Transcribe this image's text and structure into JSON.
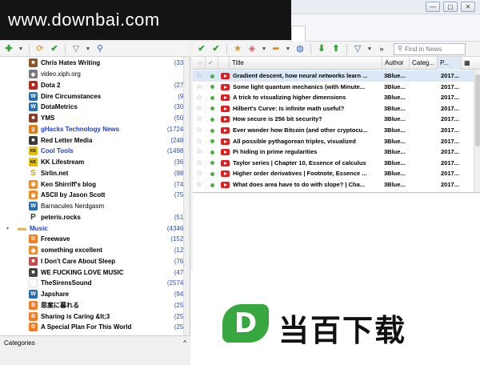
{
  "watermark": {
    "top_text": "www.downbai.com",
    "logo_letter": "D",
    "logo_text": "当百下载"
  },
  "window_controls": {
    "minimize": "—",
    "maximize": "▢",
    "close": "✕"
  },
  "feeds_toolbar": {
    "icons": [
      "add-icon",
      "dropdown-icon",
      "folder-update-icon",
      "mark-read-icon",
      "filter-icon",
      "dropdown-icon",
      "search-icon"
    ]
  },
  "news_toolbar": {
    "icons": [
      "mark-read-icon",
      "mark-all-read-icon",
      "star-icon",
      "tag-icon",
      "share-icon",
      "open-browser-icon",
      "down-icon",
      "up-icon",
      "filter-icon"
    ],
    "search_placeholder": "Find in News",
    "search_scope_label": "»"
  },
  "feeds": [
    {
      "label": "Chris Hates Writing",
      "count": "(33)",
      "style": "bold",
      "icon": "chris-icon",
      "color": "#8b5a2b",
      "glyph": "■"
    },
    {
      "label": "video.xiph.org",
      "count": "",
      "style": "thin",
      "icon": "xiph-icon",
      "color": "#7a7a7a",
      "glyph": "◆"
    },
    {
      "label": "Dota 2",
      "count": "(27)",
      "style": "bold",
      "icon": "dota-icon",
      "color": "#b5281e",
      "glyph": "■"
    },
    {
      "label": "Dire Circumstances",
      "count": "(9)",
      "style": "bold",
      "icon": "wordpress-icon",
      "color": "#2a6db0",
      "glyph": "W"
    },
    {
      "label": "DotaMetrics",
      "count": "(30)",
      "style": "bold",
      "icon": "wordpress-icon",
      "color": "#2a6db0",
      "glyph": "W"
    },
    {
      "label": "YMS",
      "count": "(50)",
      "style": "bold",
      "icon": "yms-icon",
      "color": "#8a3b2e",
      "glyph": "■"
    },
    {
      "label": "gHacks Technology News",
      "count": "(1724)",
      "style": "blue",
      "icon": "ghacks-icon",
      "color": "#e07b1a",
      "glyph": "g"
    },
    {
      "label": "Red Letter Media",
      "count": "(248)",
      "style": "bold",
      "icon": "rlm-icon",
      "color": "#3a3a3a",
      "glyph": "■"
    },
    {
      "label": "Cool Tools",
      "count": "(1498)",
      "style": "blue",
      "icon": "kk-icon",
      "color": "#e8c000",
      "glyph": "KK"
    },
    {
      "label": "KK Lifestream",
      "count": "(36)",
      "style": "bold",
      "icon": "kk-icon",
      "color": "#e8c000",
      "glyph": "KK"
    },
    {
      "label": "Sirlin.net",
      "count": "(98)",
      "style": "bold",
      "icon": "sirlin-icon",
      "color": "#c9a400",
      "glyph": "S"
    },
    {
      "label": "Ken Shirriff's blog",
      "count": "(74)",
      "style": "bold",
      "icon": "rss-icon",
      "color": "#f08a24",
      "glyph": "◉"
    },
    {
      "label": "ASCII by Jason Scott",
      "count": "(75)",
      "style": "bold",
      "icon": "rss-icon",
      "color": "#f08a24",
      "glyph": "◉"
    },
    {
      "label": "Barnacules Nerdgasm",
      "count": "",
      "style": "thin",
      "icon": "wordpress-icon",
      "color": "#2a6db0",
      "glyph": "W"
    },
    {
      "label": "peteris.rocks",
      "count": "(51)",
      "style": "bold",
      "icon": "peteris-icon",
      "color": "#333333",
      "glyph": "P"
    },
    {
      "label": "Music",
      "count": "(4346)",
      "style": "blue",
      "icon": "folder-icon",
      "color": "#e9b840",
      "glyph": "▬",
      "folder": true
    },
    {
      "label": "Freewave",
      "count": "(152)",
      "style": "bold",
      "icon": "blogger-icon",
      "color": "#f57c1f",
      "glyph": "B"
    },
    {
      "label": "something excellent",
      "count": "(12)",
      "style": "bold",
      "icon": "rss-icon",
      "color": "#f08a24",
      "glyph": "◉"
    },
    {
      "label": "I Don't Care About Sleep",
      "count": "(76)",
      "style": "bold",
      "icon": "sleep-icon",
      "color": "#c94a4a",
      "glyph": "■"
    },
    {
      "label": "WE FUCKING LOVE MUSIC",
      "count": "(47)",
      "style": "bold",
      "icon": "wflm-icon",
      "color": "#444444",
      "glyph": "■"
    },
    {
      "label": "TheSirensSound",
      "count": "(2574)",
      "style": "bold",
      "icon": "sirens-icon",
      "color": "#ffffff",
      "glyph": ""
    },
    {
      "label": "Japshare",
      "count": "(94)",
      "style": "bold",
      "icon": "wordpress-icon",
      "color": "#2a6db0",
      "glyph": "W"
    },
    {
      "label": "思案に暮れる",
      "count": "(25)",
      "style": "bold",
      "icon": "blogger-icon",
      "color": "#f57c1f",
      "glyph": "B"
    },
    {
      "label": "Sharing is Caring &lt;3",
      "count": "(25)",
      "style": "bold",
      "icon": "blogger-icon",
      "color": "#f57c1f",
      "glyph": "B"
    },
    {
      "label": "A Special Plan For This World",
      "count": "(25)",
      "style": "bold",
      "icon": "blogger-icon",
      "color": "#f57c1f",
      "glyph": "B"
    }
  ],
  "categories_bar": {
    "label": "Categories",
    "toggle": "^"
  },
  "news_columns": {
    "title": "Title",
    "author": "Author",
    "category": "Categ...",
    "published": "P..."
  },
  "news": [
    {
      "title": "Gradient descent, how neural networks learn ...",
      "author": "3Blue...",
      "published": "2017..."
    },
    {
      "title": "Some light quantum mechanics (with Minute...",
      "author": "3Blue...",
      "published": "2017..."
    },
    {
      "title": "A trick to visualizing higher dimensions",
      "author": "3Blue...",
      "published": "2017..."
    },
    {
      "title": "Hilbert's Curve: Is infinite math useful?",
      "author": "3Blue...",
      "published": "2017..."
    },
    {
      "title": "How secure is 256 bit security?",
      "author": "3Blue...",
      "published": "2017..."
    },
    {
      "title": "Ever wonder how Bitcoin (and other cryptocu...",
      "author": "3Blue...",
      "published": "2017..."
    },
    {
      "title": "All possible pythagorean triples, visualized",
      "author": "3Blue...",
      "published": "2017..."
    },
    {
      "title": "Pi hiding in prime regularities",
      "author": "3Blue...",
      "published": "2017..."
    },
    {
      "title": "Taylor series | Chapter 10, Essence of calculus",
      "author": "3Blue...",
      "published": "2017..."
    },
    {
      "title": "Higher order derivatives | Footnote, Essence ...",
      "author": "3Blue...",
      "published": "2017..."
    },
    {
      "title": "What does area have to do with slope? | Cha...",
      "author": "3Blue...",
      "published": "2017..."
    }
  ]
}
